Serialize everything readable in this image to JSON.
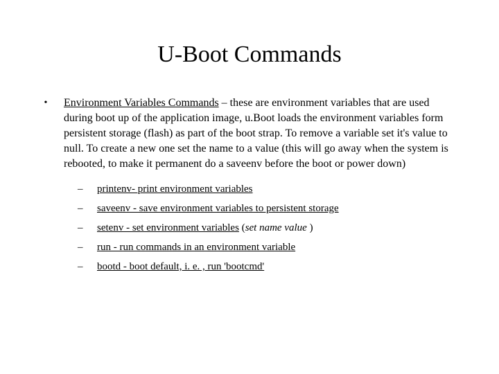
{
  "title": "U-Boot Commands",
  "bullet": {
    "lead": "Environment Variables Commands",
    "sep": " – ",
    "desc": "these are environment variables that are used during boot up of the application image, u.Boot loads the environment variables form persistent storage (flash) as part of the boot strap. To remove a variable set it's value to null. To create a new one set the name to a value (this will go away when the system is rebooted, to make it permanent do a saveenv before the boot or power down)"
  },
  "subitems": [
    {
      "link": "printenv- print environment variables",
      "tail": ""
    },
    {
      "link": "saveenv - save environment variables to persistent storage",
      "tail": ""
    },
    {
      "link": "setenv - set environment variables",
      "tail_pre": " (",
      "tail_ital": "set name value ",
      "tail_post": ")"
    },
    {
      "link": "run - run commands in an environment variable",
      "tail": ""
    },
    {
      "link": "bootd - boot default, i. e. , run 'bootcmd'",
      "tail": ""
    }
  ],
  "glyphs": {
    "dot": "•",
    "dash": "–"
  }
}
